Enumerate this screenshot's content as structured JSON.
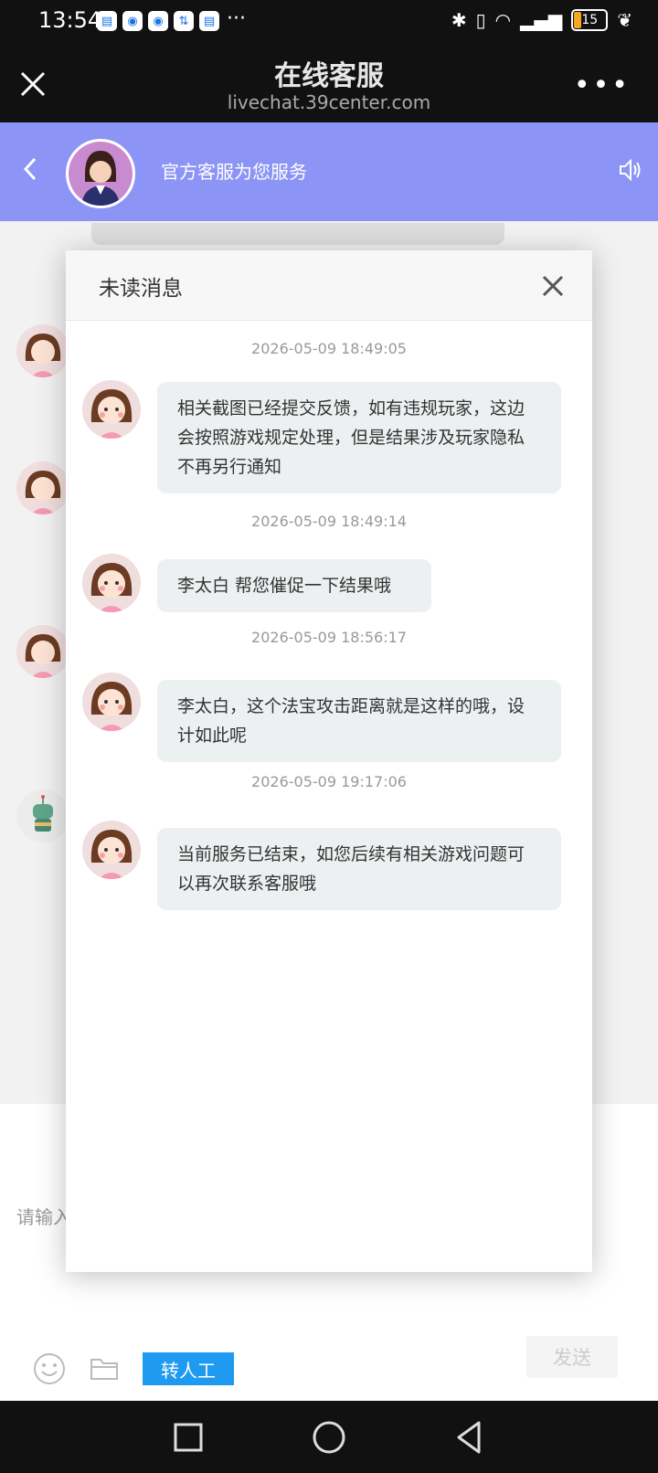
{
  "status_bar": {
    "time": "13:54",
    "more_dots": "···",
    "battery": "15"
  },
  "header": {
    "title": "在线客服",
    "url": "livechat.39center.com"
  },
  "chat_header": {
    "title": "官方客服为您服务"
  },
  "background": {
    "input_placeholder": "请输入",
    "transfer_label": "转人工",
    "send_label": "发送"
  },
  "modal": {
    "title": "未读消息",
    "messages": [
      {
        "time": "2026-05-09 18:49:05",
        "text": "相关截图已经提交反馈，如有违规玩家，这边会按照游戏规定处理，但是结果涉及玩家隐私不再另行通知"
      },
      {
        "time": "2026-05-09 18:49:14",
        "text": "李太白 帮您催促一下结果哦"
      },
      {
        "time": "2026-05-09 18:56:17",
        "text": "李太白，这个法宝攻击距离就是这样的哦，设计如此呢"
      },
      {
        "time": "2026-05-09 19:17:06",
        "text": "当前服务已结束，如您后续有相关游戏问题可以再次联系客服哦"
      }
    ]
  },
  "colors": {
    "chat_header_bg": "#8c95f5",
    "transfer_button": "#1e9bf0",
    "bubble_bg": "#ecf0f1"
  }
}
